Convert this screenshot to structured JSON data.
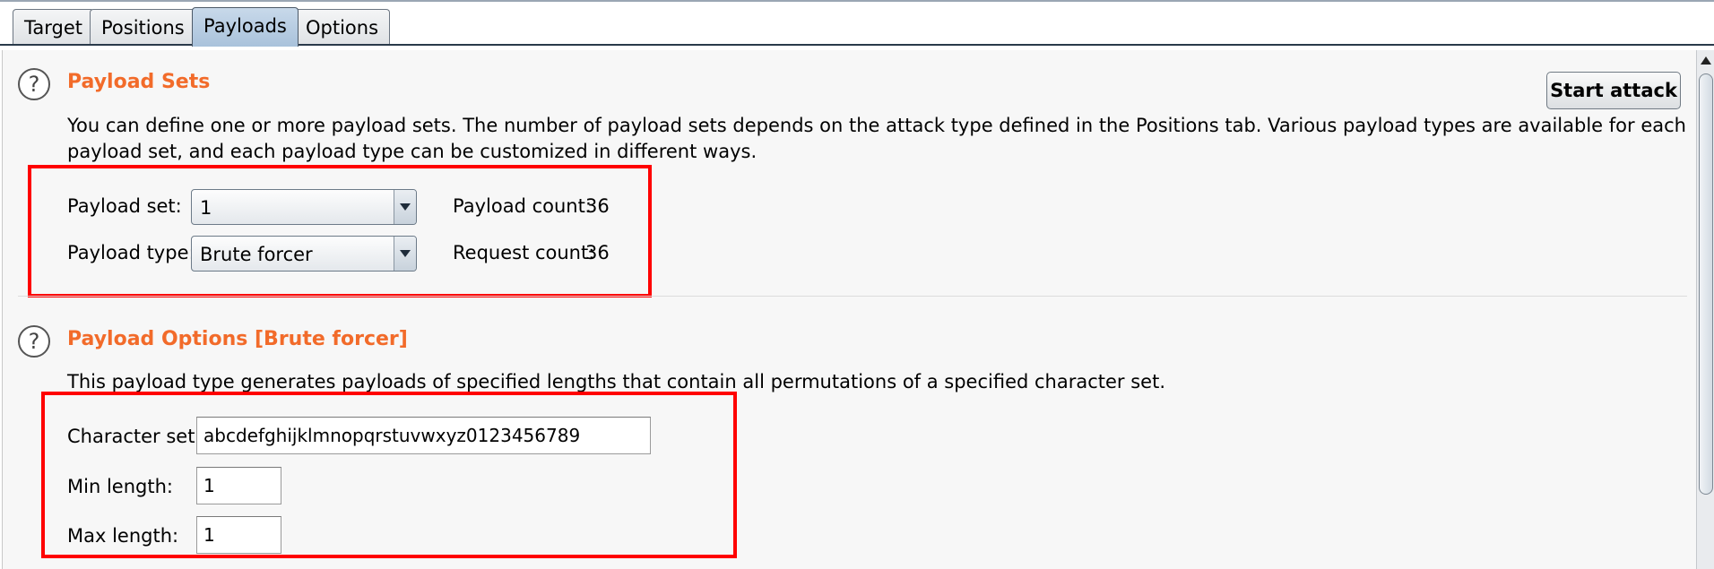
{
  "tabs": [
    {
      "label": "Target",
      "active": false
    },
    {
      "label": "Positions",
      "active": false
    },
    {
      "label": "Payloads",
      "active": true
    },
    {
      "label": "Options",
      "active": false
    }
  ],
  "payload_sets": {
    "help_icon": "question-circle-icon",
    "title": "Payload Sets",
    "description_line1": "You can define one or more payload sets. The number of payload sets depends on the attack type defined in the Positions tab. Various payload types are available for each",
    "description_line2": "payload set, and each payload type can be customized in different ways.",
    "set_label": "Payload set:",
    "set_value": "1",
    "type_label": "Payload type:",
    "type_value": "Brute forcer",
    "payload_count_label": "Payload count:",
    "payload_count": "36",
    "request_count_label": "Request count:",
    "request_count": "36",
    "start_attack_label": "Start attack"
  },
  "payload_options": {
    "help_icon": "question-circle-icon",
    "title": "Payload Options [Brute forcer]",
    "description": "This payload type generates payloads of specified lengths that contain all permutations of a specified character set.",
    "charset_label": "Character set:",
    "charset_value": "abcdefghijklmnopqrstuvwxyz0123456789",
    "min_label": "Min length:",
    "min_value": "1",
    "max_label": "Max length:",
    "max_value": "1"
  },
  "colors": {
    "section_title": "#f26b2a",
    "highlight_box": "#ff0000",
    "active_tab": "#b8cde2"
  }
}
